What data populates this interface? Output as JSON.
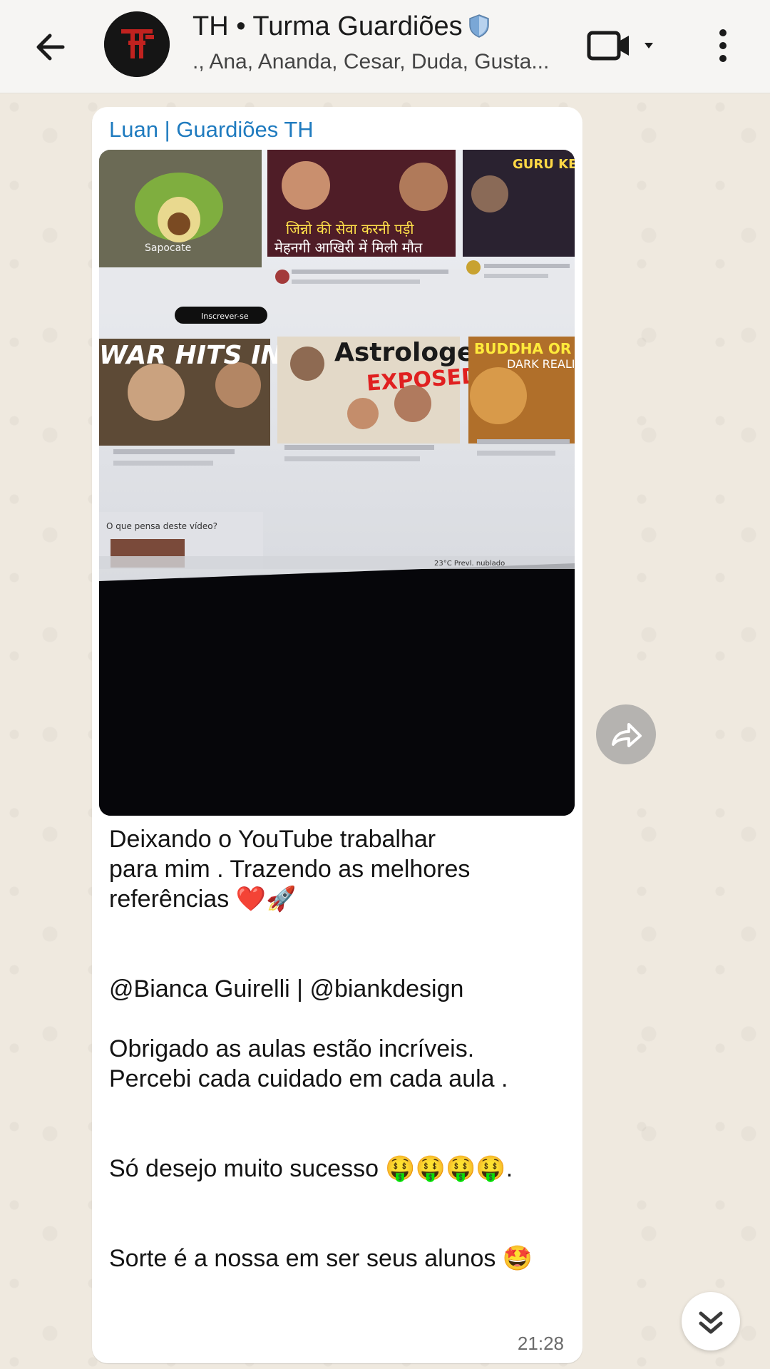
{
  "header": {
    "title": "TH • Turma Guardiões",
    "participants": "., Ana, Ananda, Cesar, Duda, Gusta..."
  },
  "message": {
    "sender": "Luan | Guardiões TH",
    "sender_color": "#1f7bbf",
    "text": "Deixando o YouTube trabalhar\npara mim . Trazendo as melhores\nreferências ❤️🚀\n\n\n@Bianca Guirelli | @biankdesign\n\nObrigado as aulas estão incríveis.\nPercebi cada cuidado em cada aula .\n\n\nSó desejo muito sucesso 🤑🤑🤑🤑.\n\n\nSorte é a nossa em ser seus alunos 🤩",
    "time": "21:28"
  },
  "photo": {
    "thumb_1_caption": "Sapocate",
    "thumb_2_title": "जिन्नो की सेवा करनी पड़ी",
    "thumb_2_subtitle": "मेहनगी आखिरी में मिली मौत",
    "thumb_3_title": "GURU KE DHOK",
    "thumb_4_title": "WAR HITS INDIA!",
    "thumb_5_title": "Astrologer",
    "thumb_5_stamp": "EXPOSED",
    "thumb_6_title": "BUDDHA OR K",
    "thumb_6_sub": "DARK REALI",
    "subscribe_label": "Inscrever-se",
    "feedback_prompt": "O que pensa deste vídeo?",
    "taskbar_weather": "23°C  Prevl. nublado"
  },
  "icons": {
    "back": "arrow-back-icon",
    "video": "video-call-icon",
    "menu": "more-vert-icon",
    "forward": "forward-icon",
    "scroll": "double-chevron-down-icon",
    "shield": "shield-icon"
  }
}
